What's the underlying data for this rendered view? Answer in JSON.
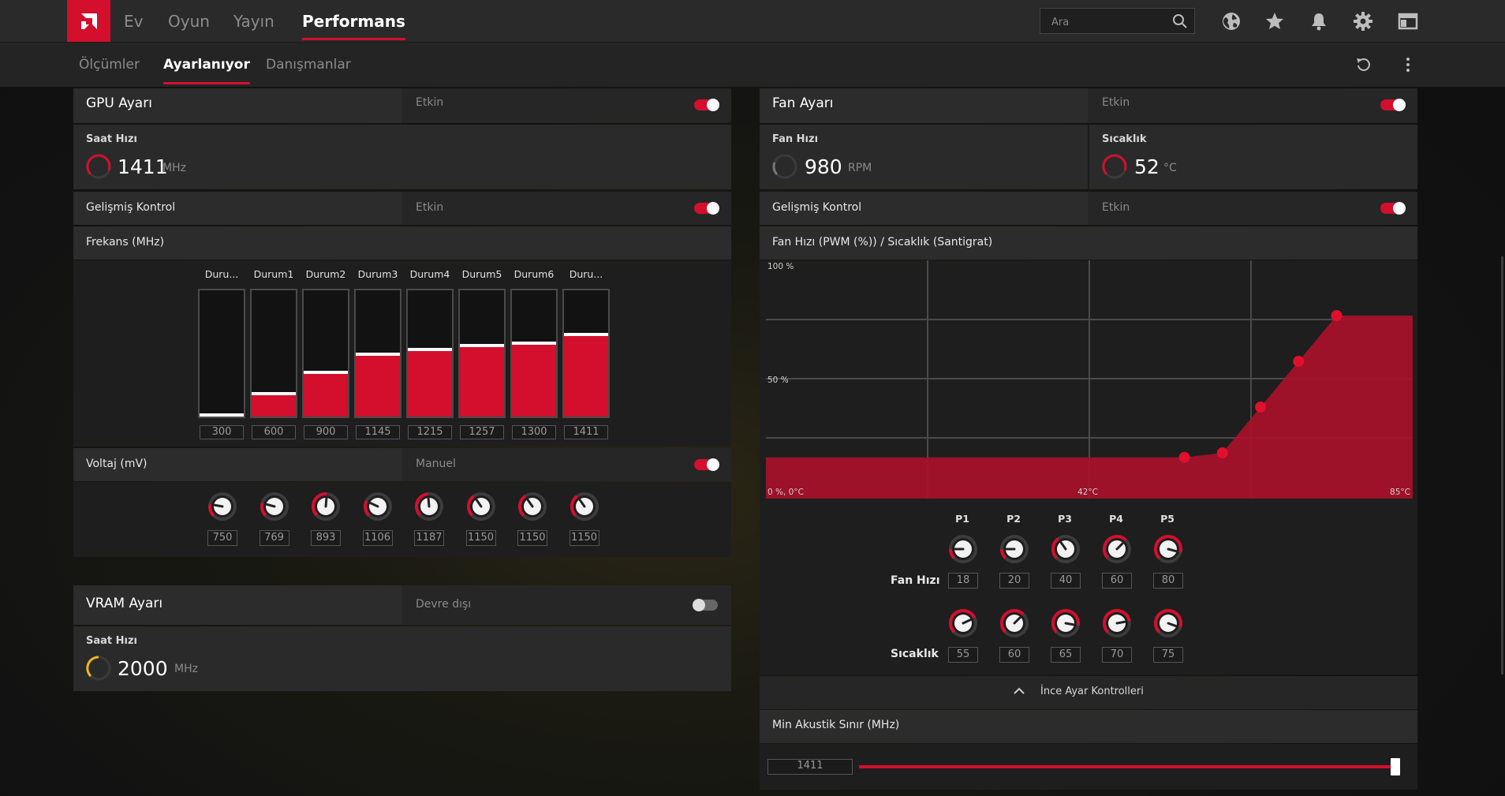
{
  "topnav": {
    "items": [
      {
        "label": "Ev"
      },
      {
        "label": "Oyun"
      },
      {
        "label": "Yayın"
      },
      {
        "label": "Performans"
      }
    ],
    "search_placeholder": "Ara",
    "icons": [
      "globe-icon",
      "star-icon",
      "bell-icon",
      "gear-icon",
      "sidebar-panel-icon"
    ]
  },
  "subnav": {
    "items": [
      {
        "label": "Ölçümler"
      },
      {
        "label": "Ayarlanıyor"
      },
      {
        "label": "Danışmanlar"
      }
    ],
    "icons": [
      "reset-icon",
      "more-vertical-icon"
    ]
  },
  "gpu": {
    "title": "GPU Ayarı",
    "status": "Etkin",
    "clock_label": "Saat Hızı",
    "clock_value": "1411",
    "clock_unit": "MHz",
    "advanced_label": "Gelişmiş Kontrol",
    "advanced_status": "Etkin",
    "freq_title": "Frekans (MHz)",
    "states": [
      {
        "label": "Duru...",
        "value": 300,
        "level": 0.0
      },
      {
        "label": "Durum1",
        "value": 600,
        "level": 0.17
      },
      {
        "label": "Durum2",
        "value": 900,
        "level": 0.34
      },
      {
        "label": "Durum3",
        "value": 1145,
        "level": 0.48
      },
      {
        "label": "Durum4",
        "value": 1215,
        "level": 0.52
      },
      {
        "label": "Durum5",
        "value": 1257,
        "level": 0.55
      },
      {
        "label": "Durum6",
        "value": 1300,
        "level": 0.57
      },
      {
        "label": "Duru...",
        "value": 1411,
        "level": 0.64
      }
    ],
    "voltage_title": "Voltaj (mV)",
    "voltage_mode": "Manuel",
    "voltages": [
      {
        "value": 750,
        "angle": 55
      },
      {
        "value": 769,
        "angle": 60
      },
      {
        "value": 893,
        "angle": 140
      },
      {
        "value": 1106,
        "angle": 70
      },
      {
        "value": 1187,
        "angle": 130
      },
      {
        "value": 1150,
        "angle": 100
      },
      {
        "value": 1150,
        "angle": 100
      },
      {
        "value": 1150,
        "angle": 100
      }
    ]
  },
  "vram": {
    "title": "VRAM Ayarı",
    "status": "Devre dışı",
    "clock_label": "Saat Hızı",
    "clock_value": "2000",
    "clock_unit": "MHz"
  },
  "fan": {
    "title": "Fan Ayarı",
    "status": "Etkin",
    "speed_label": "Fan Hızı",
    "speed_value": "980",
    "speed_unit": "RPM",
    "temp_label": "Sıcaklık",
    "temp_value": "52",
    "temp_unit": "°C",
    "advanced_label": "Gelişmiş Kontrol",
    "advanced_status": "Etkin",
    "curve_title": "Fan Hızı (PWM (%)) / Sıcaklık (Santigrat)",
    "points_label": [
      "P1",
      "P2",
      "P3",
      "P4",
      "P5"
    ],
    "speed_row_label": "Fan Hızı",
    "temp_row_label": "Sıcaklık",
    "fine_tune_label": "İnce Ayar Kontrolleri",
    "min_acoustic_title": "Min Akustik Sınır (MHz)",
    "min_acoustic_value": "1411",
    "min_acoustic_level": 1.0
  },
  "chart_data": {
    "type": "area",
    "x_label_min": "0 %, 0°C",
    "x_label_mid": "42°C",
    "x_label_max": "85°C",
    "y_label_max": "100 %",
    "y_label_mid": "50 %",
    "x_range": [
      0,
      85
    ],
    "y_range": [
      0,
      100
    ],
    "points": [
      {
        "x": 55,
        "y": 18
      },
      {
        "x": 60,
        "y": 20
      },
      {
        "x": 65,
        "y": 40
      },
      {
        "x": 70,
        "y": 60
      },
      {
        "x": 75,
        "y": 80
      }
    ],
    "fill_color": "#a8102a",
    "point_color": "#e0102d"
  },
  "fan_speed_knobs": [
    {
      "value": "18",
      "angle": 45
    },
    {
      "value": "20",
      "angle": 45
    },
    {
      "value": "40",
      "angle": 100
    },
    {
      "value": "60",
      "angle": 180
    },
    {
      "value": "80",
      "angle": 240
    }
  ],
  "fan_temp_knobs": [
    {
      "value": "55",
      "angle": 200
    },
    {
      "value": "60",
      "angle": 180
    },
    {
      "value": "65",
      "angle": 235
    },
    {
      "value": "70",
      "angle": 215
    },
    {
      "value": "75",
      "angle": 245
    }
  ],
  "colors": {
    "accent": "#d30f2d",
    "vram_accent": "#f2b424"
  }
}
